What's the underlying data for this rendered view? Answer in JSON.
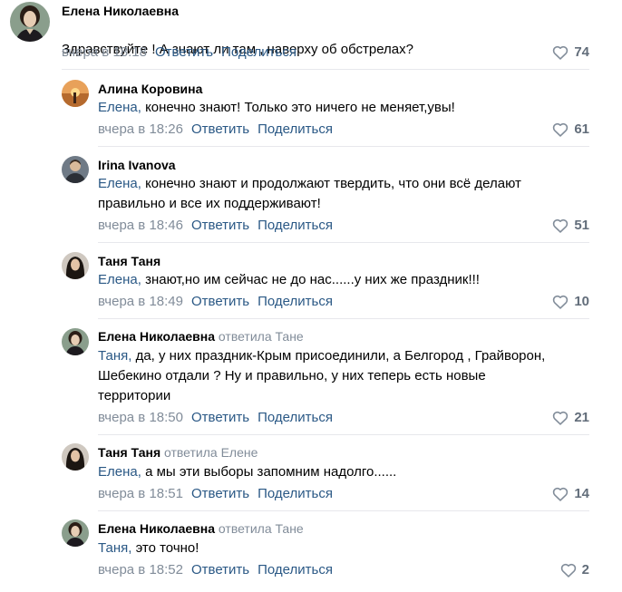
{
  "comments": [
    {
      "author": "Елена Николаевна",
      "reply_to": "",
      "addressee": "",
      "text": "Здравствуйте ! А знают ли там , наверху об обстрелах?",
      "time": "вчера в 18:18",
      "reply_label": "Ответить",
      "share_label": "Поделиться",
      "likes": "74",
      "avatar": "portrait-woman-dark-dress"
    },
    {
      "author": "Алина Коровина",
      "reply_to": "",
      "addressee": "Елена,",
      "text": " конечно знают! Только это ничего не меняет,увы!",
      "time": "вчера в 18:26",
      "reply_label": "Ответить",
      "share_label": "Поделиться",
      "likes": "61",
      "avatar": "sunset-photo"
    },
    {
      "author": "Irina Ivanova",
      "reply_to": "",
      "addressee": "Елена,",
      "text": " конечно знают и продолжают твердить, что они всё делают\nправильно и все их поддерживают!",
      "time": "вчера в 18:46",
      "reply_label": "Ответить",
      "share_label": "Поделиться",
      "likes": "51",
      "avatar": "person-photo"
    },
    {
      "author": "Таня Таня",
      "reply_to": "",
      "addressee": "Елена,",
      "text": " знают,но им сейчас не до нас......у них же праздник!!!",
      "time": "вчера в 18:49",
      "reply_label": "Ответить",
      "share_label": "Поделиться",
      "likes": "10",
      "avatar": "woman-dark-hair"
    },
    {
      "author": "Елена Николаевна",
      "reply_to": "ответила Тане",
      "addressee": "Таня,",
      "text": " да, у них праздник-Крым присоединили, а Белгород , Грайворон,\nШебекино отдали ? Ну и правильно, у них теперь есть новые\nтерритории",
      "time": "вчера в 18:50",
      "reply_label": "Ответить",
      "share_label": "Поделиться",
      "likes": "21",
      "avatar": "portrait-woman-dark-dress"
    },
    {
      "author": "Таня Таня",
      "reply_to": "ответила Елене",
      "addressee": "Елена,",
      "text": " а мы эти выборы запомним надолго......",
      "time": "вчера в 18:51",
      "reply_label": "Ответить",
      "share_label": "Поделиться",
      "likes": "14",
      "avatar": "woman-dark-hair"
    },
    {
      "author": "Елена Николаевна",
      "reply_to": "ответила Тане",
      "addressee": "Таня,",
      "text": " это точно!",
      "time": "вчера в 18:52",
      "reply_label": "Ответить",
      "share_label": "Поделиться",
      "likes": "2",
      "avatar": "portrait-woman-dark-dress"
    }
  ]
}
